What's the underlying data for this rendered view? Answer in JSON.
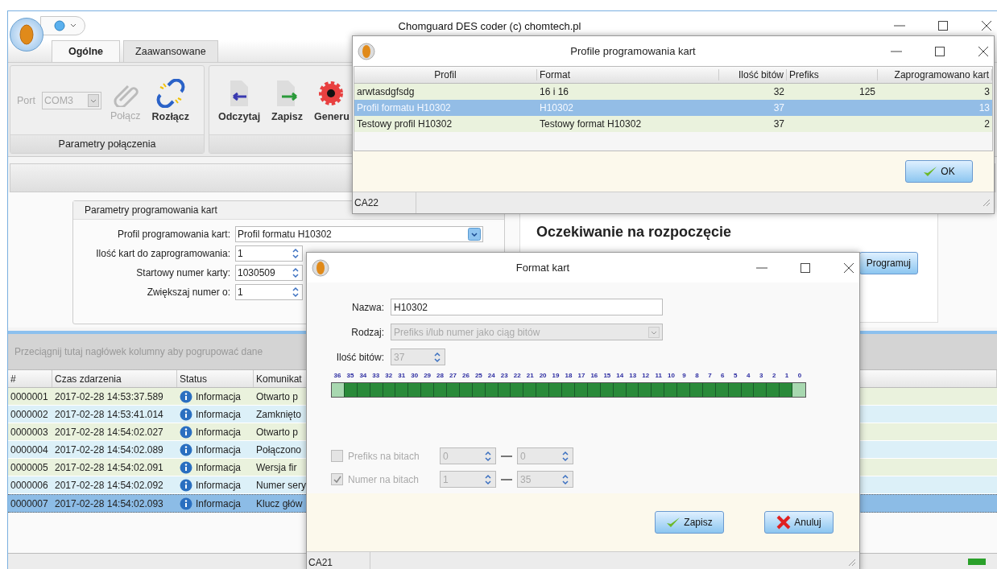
{
  "main_window": {
    "title": "Chomguard DES coder (c) chomtech.pl",
    "ribbon": {
      "tabs": [
        {
          "label": "Ogólne",
          "selected": true
        },
        {
          "label": "Zaawansowane",
          "selected": false
        }
      ],
      "groups": [
        {
          "label": "Parametry połączenia",
          "items": [
            {
              "kind": "combo",
              "label": "Port",
              "value": "COM3",
              "disabled": true
            },
            {
              "kind": "button",
              "label": "Połącz",
              "disabled": true
            },
            {
              "kind": "button",
              "label": "Rozłącz",
              "disabled": false
            }
          ]
        },
        {
          "items": [
            {
              "kind": "button",
              "label": "Odczytaj",
              "disabled": false
            },
            {
              "kind": "button",
              "label": "Zapisz",
              "disabled": false
            },
            {
              "kind": "button",
              "label": "Generu",
              "disabled": false
            }
          ]
        }
      ]
    },
    "programming_params": {
      "title": "Parametry programowania kart",
      "fields": [
        {
          "kind": "combo",
          "label": "Profil programowania kart:",
          "value": "Profil formatu H10302"
        },
        {
          "kind": "spinner",
          "label": "Ilość kart do zaprogramowania:",
          "value": "1"
        },
        {
          "kind": "spinner",
          "label": "Startowy numer karty:",
          "value": "1030509"
        },
        {
          "kind": "spinner",
          "label": "Zwiększaj numer o:",
          "value": "1"
        }
      ]
    },
    "status_panel": {
      "message": "Oczekiwanie na rozpoczęcie",
      "button": "Programuj"
    },
    "log": {
      "group_hint": "Przeciągnij tutaj nagłówek kolumny aby pogrupować dane",
      "columns": [
        "#",
        "Czas zdarzenia",
        "Status",
        "Komunikat"
      ],
      "rows": [
        {
          "id": "0000001",
          "time": "2017-02-28 14:53:37.589",
          "status": "Informacja",
          "message": "Otwarto p",
          "selected": false
        },
        {
          "id": "0000002",
          "time": "2017-02-28 14:53:41.014",
          "status": "Informacja",
          "message": "Zamknięto",
          "selected": false
        },
        {
          "id": "0000003",
          "time": "2017-02-28 14:54:02.027",
          "status": "Informacja",
          "message": "Otwarto p",
          "selected": false
        },
        {
          "id": "0000004",
          "time": "2017-02-28 14:54:02.089",
          "status": "Informacja",
          "message": "Połączono",
          "selected": false
        },
        {
          "id": "0000005",
          "time": "2017-02-28 14:54:02.091",
          "status": "Informacja",
          "message": "Wersja fir",
          "selected": false
        },
        {
          "id": "0000006",
          "time": "2017-02-28 14:54:02.092",
          "status": "Informacja",
          "message": "Numer sery",
          "selected": false
        },
        {
          "id": "0000007",
          "time": "2017-02-28 14:54:02.093",
          "status": "Informacja",
          "message": "Klucz głów",
          "selected": true
        }
      ]
    }
  },
  "profiles_dialog": {
    "title": "Profile programowania kart",
    "columns": [
      "Profil",
      "Format",
      "Ilość bitów",
      "Prefiks",
      "Zaprogramowano kart"
    ],
    "rows": [
      {
        "cells": [
          "arwtasdgfsdg",
          "16 i 16",
          "32",
          "125",
          "3"
        ],
        "selected": false
      },
      {
        "cells": [
          "Profil formatu H10302",
          "H10302",
          "37",
          "",
          "13"
        ],
        "selected": true
      },
      {
        "cells": [
          "Testowy profil H10302",
          "Testowy format H10302",
          "37",
          "",
          "2"
        ],
        "selected": false
      }
    ],
    "ok_button": "OK",
    "status": "CA22"
  },
  "format_dialog": {
    "title": "Format kart",
    "name": {
      "label": "Nazwa:",
      "value": "H10302"
    },
    "type": {
      "label": "Rodzaj:",
      "value": "Prefiks i/lub numer jako ciąg bitów",
      "disabled": true
    },
    "bit_count": {
      "label": "Ilość bitów:",
      "value": "37",
      "disabled": true
    },
    "bits": [
      {
        "label": "36",
        "used": false
      },
      {
        "label": "35",
        "used": true
      },
      {
        "label": "34",
        "used": true
      },
      {
        "label": "33",
        "used": true
      },
      {
        "label": "32",
        "used": true
      },
      {
        "label": "31",
        "used": true
      },
      {
        "label": "30",
        "used": true
      },
      {
        "label": "29",
        "used": true
      },
      {
        "label": "28",
        "used": true
      },
      {
        "label": "27",
        "used": true
      },
      {
        "label": "26",
        "used": true
      },
      {
        "label": "25",
        "used": true
      },
      {
        "label": "24",
        "used": true
      },
      {
        "label": "23",
        "used": true
      },
      {
        "label": "22",
        "used": true
      },
      {
        "label": "21",
        "used": true
      },
      {
        "label": "20",
        "used": true
      },
      {
        "label": "19",
        "used": true
      },
      {
        "label": "18",
        "used": true
      },
      {
        "label": "17",
        "used": true
      },
      {
        "label": "16",
        "used": true
      },
      {
        "label": "15",
        "used": true
      },
      {
        "label": "14",
        "used": true
      },
      {
        "label": "13",
        "used": true
      },
      {
        "label": "12",
        "used": true
      },
      {
        "label": "11",
        "used": true
      },
      {
        "label": "10",
        "used": true
      },
      {
        "label": "9",
        "used": true
      },
      {
        "label": "8",
        "used": true
      },
      {
        "label": "7",
        "used": true
      },
      {
        "label": "6",
        "used": true
      },
      {
        "label": "5",
        "used": true
      },
      {
        "label": "4",
        "used": true
      },
      {
        "label": "3",
        "used": true
      },
      {
        "label": "2",
        "used": true
      },
      {
        "label": "1",
        "used": true
      },
      {
        "label": "0",
        "used": false
      }
    ],
    "ranges": [
      {
        "label": "Prefiks na bitach",
        "checked": false,
        "disabled": true,
        "from": "0",
        "to": "0"
      },
      {
        "label": "Numer na bitach",
        "checked": true,
        "disabled": true,
        "from": "1",
        "to": "35"
      }
    ],
    "save_button": "Zapisz",
    "cancel_button": "Anuluj",
    "status": "CA21"
  }
}
